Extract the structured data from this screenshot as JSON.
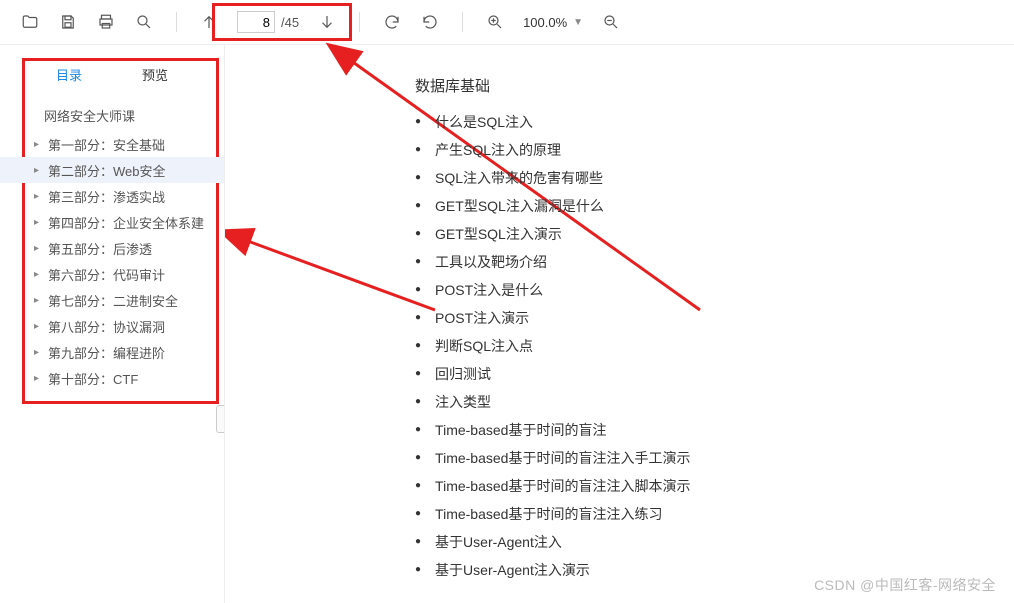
{
  "toolbar": {
    "page_current": "8",
    "page_total": "/45",
    "zoom": "100.0%"
  },
  "sidebar": {
    "tabs": {
      "outline": "目录",
      "preview": "预览"
    },
    "root_title": "网络安全大师课",
    "items": [
      {
        "label": "第一部分：安全基础"
      },
      {
        "label": "第二部分：Web安全",
        "selected": true
      },
      {
        "label": "第三部分：渗透实战"
      },
      {
        "label": "第四部分：企业安全体系建"
      },
      {
        "label": "第五部分：后渗透"
      },
      {
        "label": "第六部分：代码审计"
      },
      {
        "label": "第七部分：二进制安全"
      },
      {
        "label": "第八部分：协议漏洞"
      },
      {
        "label": "第九部分：编程进阶"
      },
      {
        "label": "第十部分：CTF"
      }
    ]
  },
  "content": {
    "heading": "数据库基础",
    "bullets": [
      "什么是SQL注入",
      "产生SQL注入的原理",
      "SQL注入带来的危害有哪些",
      "GET型SQL注入漏洞是什么",
      "GET型SQL注入演示",
      "工具以及靶场介绍",
      "POST注入是什么",
      "POST注入演示",
      "判断SQL注入点",
      "回归测试",
      "注入类型",
      "Time-based基于时间的盲注",
      "Time-based基于时间的盲注注入手工演示",
      "Time-based基于时间的盲注注入脚本演示",
      "Time-based基于时间的盲注注入练习",
      "基于User-Agent注入",
      "基于User-Agent注入演示"
    ]
  },
  "watermark": "CSDN @中国红客-网络安全"
}
